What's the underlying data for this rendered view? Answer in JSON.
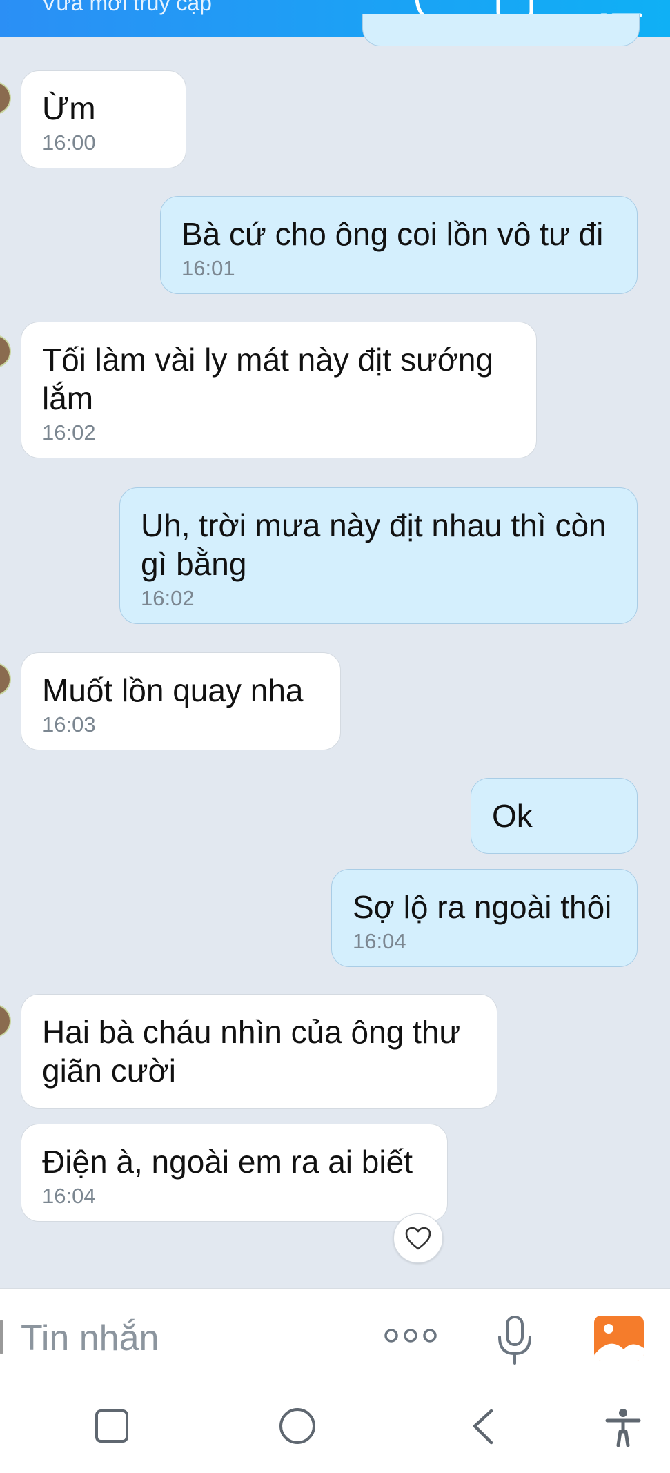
{
  "header": {
    "status": "Vừa mới truy cập"
  },
  "icons": {
    "call": "phone-icon",
    "video": "video-icon",
    "menu": "menu-icon",
    "reaction": "heart-icon",
    "more": "more-options-icon",
    "mic": "microphone-icon",
    "gallery": "image-icon"
  },
  "messages": [
    {
      "side": "in",
      "text": "Ừm",
      "time": "16:00"
    },
    {
      "side": "out",
      "text": "Bà cứ cho ông coi lồn vô tư đi",
      "time": "16:01"
    },
    {
      "side": "in",
      "text": "Tối làm vài ly mát này địt sướng lắm",
      "time": "16:02"
    },
    {
      "side": "out",
      "text": "Uh, trời mưa này địt nhau thì còn gì bằng",
      "time": "16:02"
    },
    {
      "side": "in",
      "text": "Muốt lồn quay nha",
      "time": "16:03"
    },
    {
      "side": "out",
      "text": "Ok",
      "time": ""
    },
    {
      "side": "out",
      "text": "Sợ lộ ra ngoài thôi",
      "time": "16:04"
    },
    {
      "side": "in",
      "text": "Hai bà cháu nhìn của ông thư giãn cười",
      "time": ""
    },
    {
      "side": "in",
      "text": "Điện à, ngoài em ra ai biết",
      "time": "16:04"
    }
  ],
  "composer": {
    "placeholder": "Tin nhắn"
  },
  "colors": {
    "header_start": "#2b8ff5",
    "header_end": "#0fb0f5",
    "outgoing_bubble": "#d4effd",
    "incoming_bubble": "#ffffff",
    "chat_background": "#e2e8f0",
    "gallery_accent": "#f57c2b"
  }
}
